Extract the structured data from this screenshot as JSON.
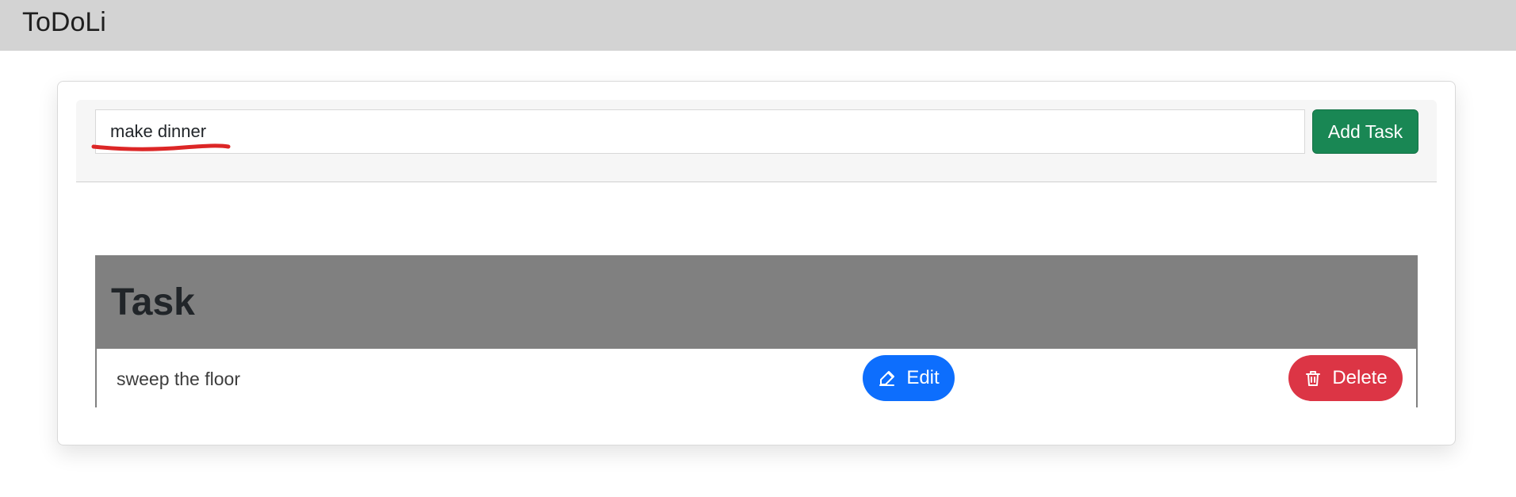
{
  "app": {
    "title": "ToDoLi"
  },
  "task_form": {
    "input_value": "make dinner",
    "add_button_label": "Add Task"
  },
  "task_table": {
    "header": "Task",
    "rows": [
      {
        "task": "sweep the floor",
        "edit_label": "Edit",
        "delete_label": "Delete"
      }
    ]
  },
  "colors": {
    "header_background": "#d3d3d3",
    "add_button": "#198754",
    "edit_button": "#0d6efd",
    "delete_button": "#dc3545",
    "table_header": "#808080",
    "annotation_underline": "#dc2626"
  },
  "icons": {
    "edit": "edit-square-icon",
    "delete": "trash-icon"
  }
}
